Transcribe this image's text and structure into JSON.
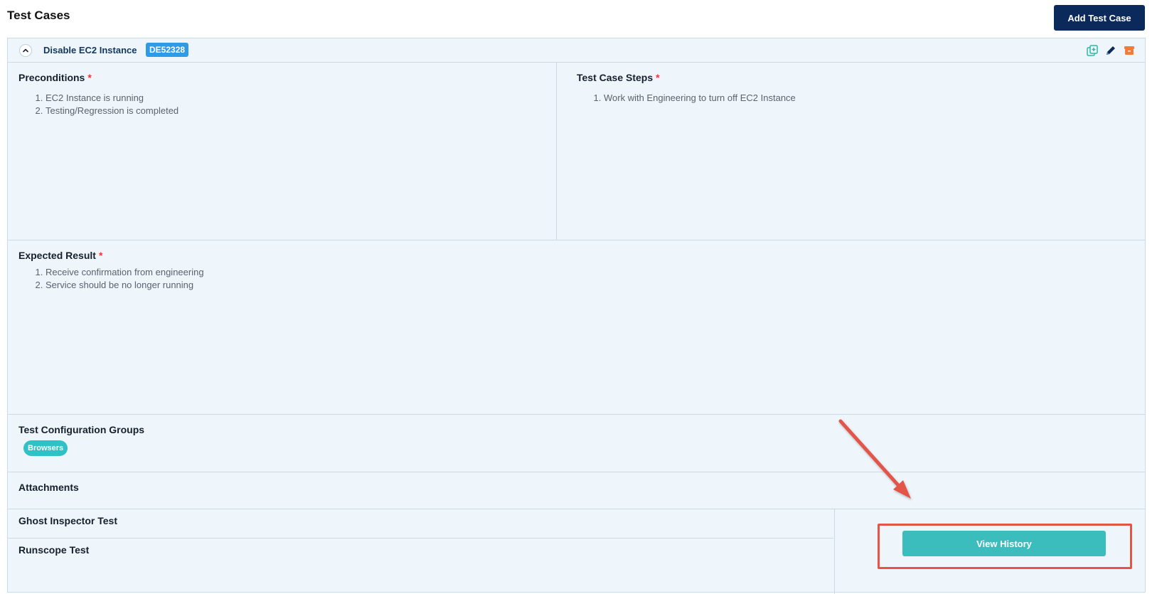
{
  "page": {
    "title": "Test Cases",
    "add_button_label": "Add Test Case"
  },
  "test_case": {
    "title": "Disable EC2 Instance",
    "id": "DE52328",
    "preconditions": {
      "label": "Preconditions",
      "required_mark": "*",
      "items": [
        "EC2 Instance is running",
        "Testing/Regression is completed"
      ]
    },
    "steps": {
      "label": "Test Case Steps",
      "required_mark": "*",
      "items": [
        "Work with Engineering to turn off EC2 Instance"
      ]
    },
    "expected_result": {
      "label": "Expected Result",
      "required_mark": "*",
      "items": [
        "Receive confirmation from engineering",
        "Service should be no longer running"
      ]
    },
    "config_groups": {
      "label": "Test Configuration Groups",
      "tags": [
        "Browsers"
      ]
    },
    "attachments": {
      "label": "Attachments"
    },
    "ghost_inspector": {
      "label": "Ghost Inspector Test"
    },
    "runscope": {
      "label": "Runscope Test"
    },
    "view_history_label": "View History",
    "header_icons": [
      "duplicate-icon",
      "edit-pencil-icon",
      "archive-icon"
    ]
  },
  "colors": {
    "primary_navy": "#0b2a5b",
    "badge_blue": "#2f9be6",
    "teal": "#3cbdbd",
    "required_red": "#e53935",
    "annotation_red": "#e45548",
    "card_bg": "#eef6fc"
  }
}
